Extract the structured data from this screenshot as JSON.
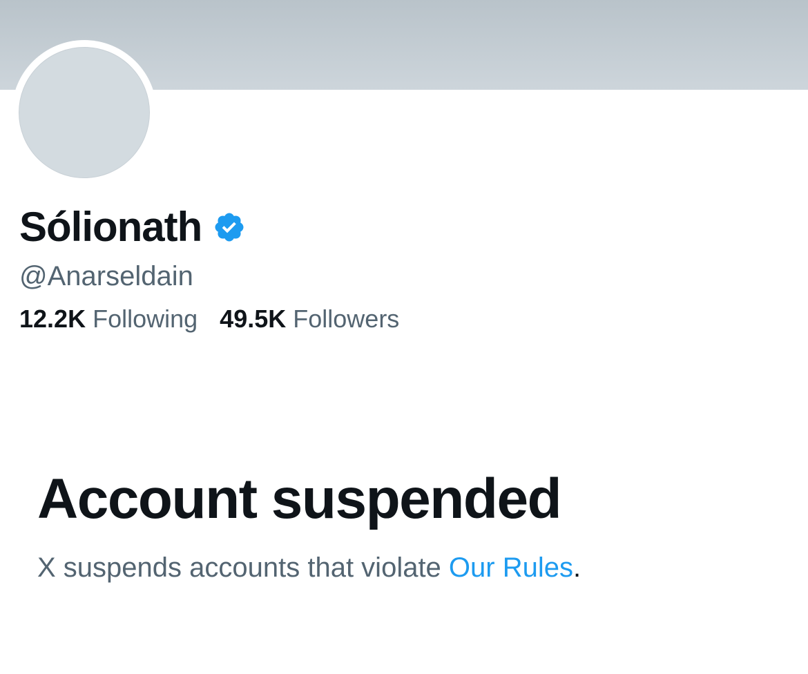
{
  "colors": {
    "banner_top": "#b9c3ca",
    "banner_bottom": "#cdd5db",
    "avatar_fill": "#d3dbe0",
    "verified_badge": "#1d9bf0",
    "link": "#1d9bf0",
    "primary_text": "#0f1419",
    "secondary_text": "#536471"
  },
  "profile": {
    "display_name": "Sólionath",
    "verified_icon": "verified-badge-icon",
    "handle": "@Anarseldain",
    "following_count": "12.2K",
    "following_label": "Following",
    "followers_count": "49.5K",
    "followers_label": "Followers"
  },
  "suspension": {
    "title": "Account suspended",
    "message": "X suspends accounts that violate ",
    "link_text": "Our Rules",
    "period": "."
  }
}
